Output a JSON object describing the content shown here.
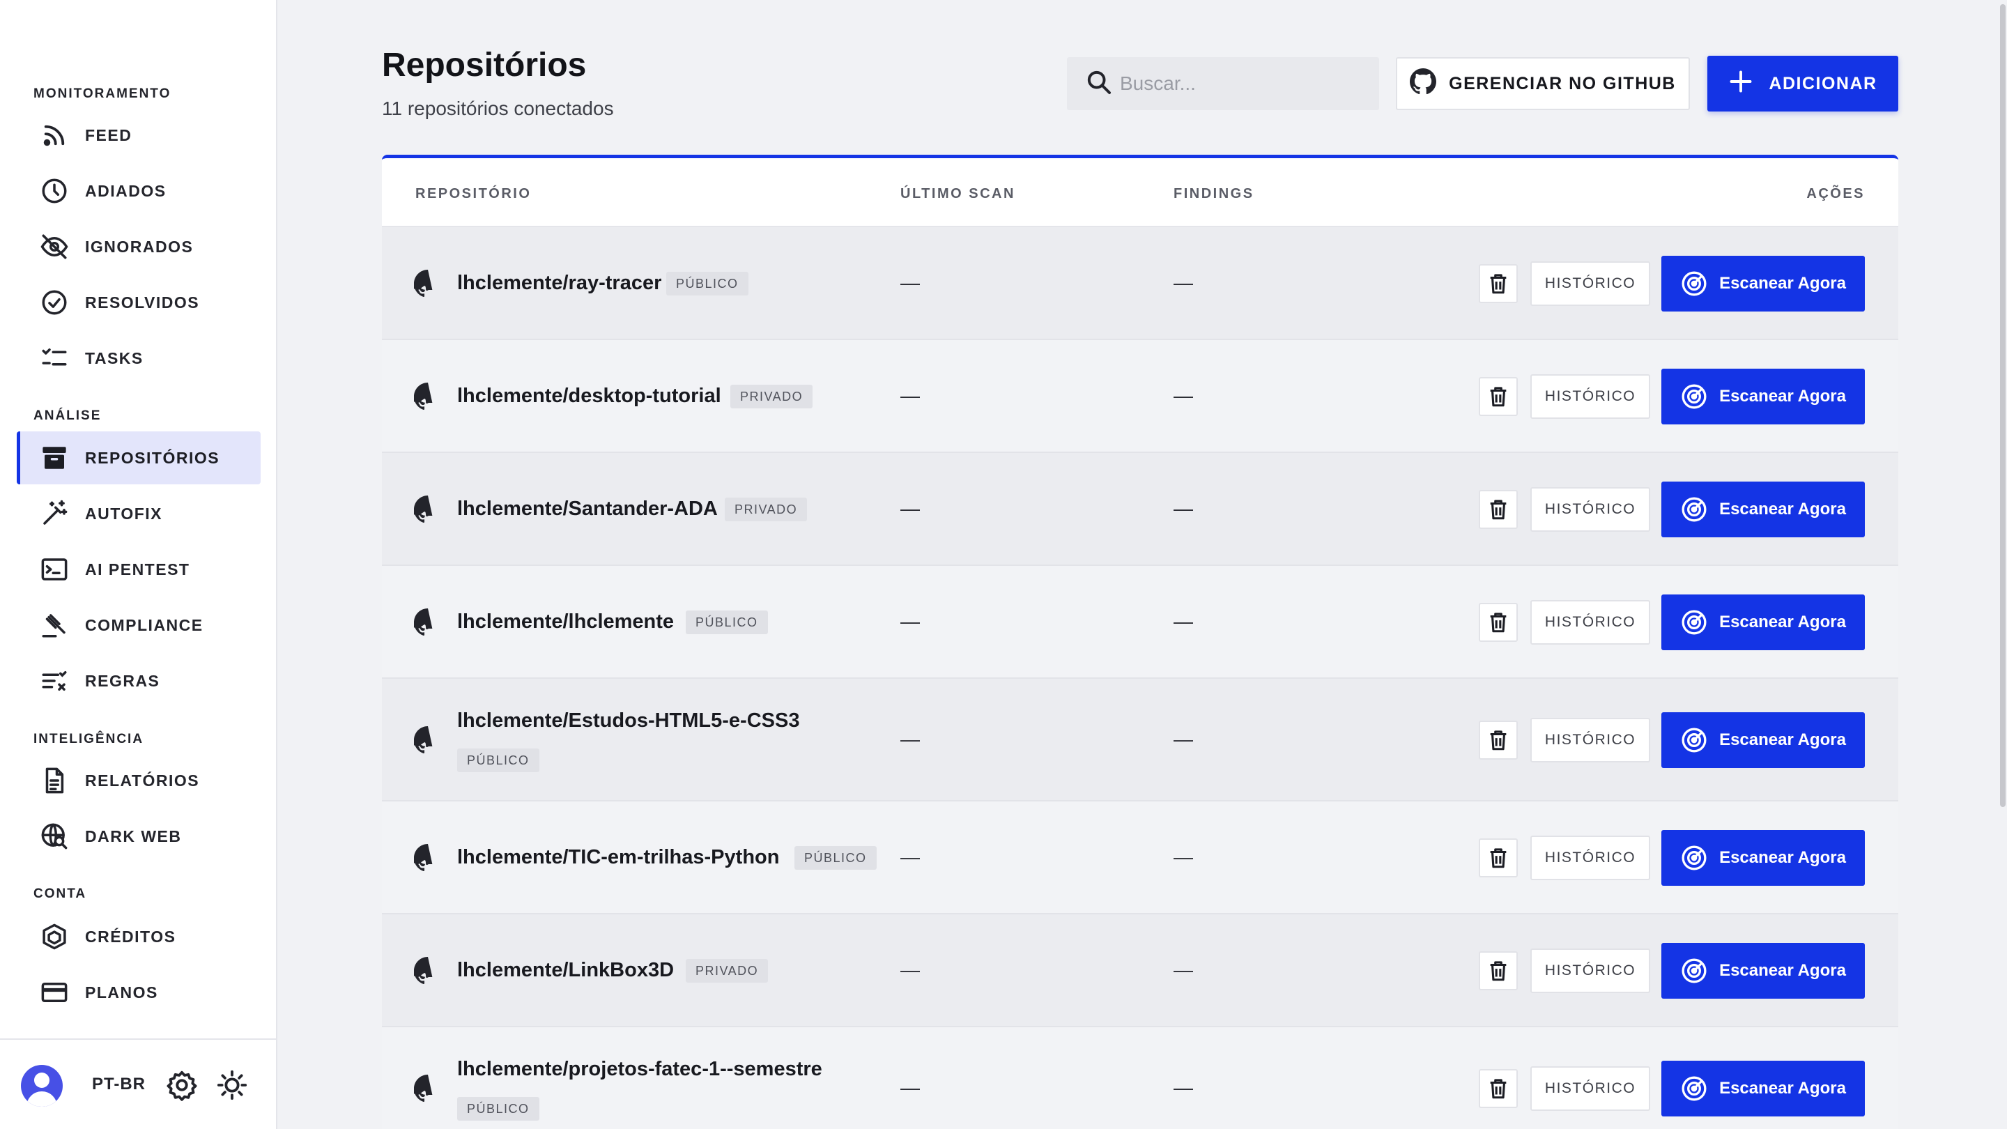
{
  "sidebar": {
    "sections": [
      {
        "title": "MONITORAMENTO",
        "items": [
          {
            "label": "FEED",
            "icon": "rss-feed-icon"
          },
          {
            "label": "ADIADOS",
            "icon": "clock-icon"
          },
          {
            "label": "IGNORADOS",
            "icon": "eye-off-icon"
          },
          {
            "label": "RESOLVIDOS",
            "icon": "check-circle-icon"
          },
          {
            "label": "TASKS",
            "icon": "checklist-icon"
          }
        ]
      },
      {
        "title": "ANÁLISE",
        "items": [
          {
            "label": "REPOSITÓRIOS",
            "icon": "archive-box-icon",
            "active": true
          },
          {
            "label": "AUTOFIX",
            "icon": "magic-wand-icon"
          },
          {
            "label": "AI PENTEST",
            "icon": "terminal-icon"
          },
          {
            "label": "COMPLIANCE",
            "icon": "gavel-icon"
          },
          {
            "label": "REGRAS",
            "icon": "rules-icon"
          }
        ]
      },
      {
        "title": "INTELIGÊNCIA",
        "items": [
          {
            "label": "RELATÓRIOS",
            "icon": "document-icon"
          },
          {
            "label": "DARK WEB",
            "icon": "globe-search-icon"
          }
        ]
      },
      {
        "title": "CONTA",
        "items": [
          {
            "label": "CRÉDITOS",
            "icon": "cube-icon"
          },
          {
            "label": "PLANOS",
            "icon": "credit-card-icon"
          }
        ]
      }
    ],
    "footer": {
      "language": "PT-BR",
      "settings_icon": "gear-icon",
      "theme_icon": "sun-icon"
    }
  },
  "header": {
    "title": "Repositórios",
    "subtitle": "11 repositórios conectados",
    "search_placeholder": "Buscar...",
    "github_button": "GERENCIAR NO GITHUB",
    "add_button": "ADICIONAR"
  },
  "table": {
    "columns": {
      "repo": "REPOSITÓRIO",
      "last_scan": "ÚLTIMO SCAN",
      "findings": "FINDINGS",
      "actions": "AÇÕES"
    },
    "history_label": "HISTÓRICO",
    "scan_label": "Escanear Agora",
    "rows": [
      {
        "name": "lhclemente/ray-tracer",
        "visibility": "PÚBLICO",
        "last_scan": "—",
        "findings": "—"
      },
      {
        "name": "lhclemente/desktop-tutorial",
        "visibility": "PRIVADO",
        "last_scan": "—",
        "findings": "—"
      },
      {
        "name": "lhclemente/Santander-ADA",
        "visibility": "PRIVADO",
        "last_scan": "—",
        "findings": "—"
      },
      {
        "name": "lhclemente/lhclemente",
        "visibility": "PÚBLICO",
        "last_scan": "—",
        "findings": "—"
      },
      {
        "name": "lhclemente/Estudos-HTML5-e-CSS3",
        "visibility": "PÚBLICO",
        "last_scan": "—",
        "findings": "—"
      },
      {
        "name": "lhclemente/TIC-em-trilhas-Python",
        "visibility": "PÚBLICO",
        "last_scan": "—",
        "findings": "—"
      },
      {
        "name": "lhclemente/LinkBox3D",
        "visibility": "PRIVADO",
        "last_scan": "—",
        "findings": "—"
      },
      {
        "name": "lhclemente/projetos-fatec-1--semestre",
        "visibility": "PÚBLICO",
        "last_scan": "—",
        "findings": "—"
      }
    ]
  },
  "colors": {
    "accent": "#1434e5",
    "background": "#f1f2f5",
    "sidebar_active": "#e3e5fb"
  }
}
